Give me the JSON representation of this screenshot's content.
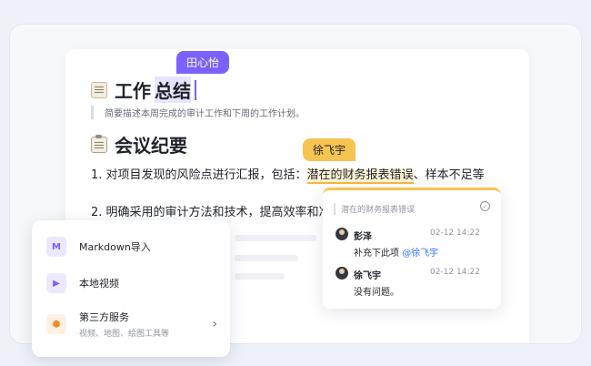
{
  "doc": {
    "heading1": {
      "text_plain": "工作",
      "text_selected": "总结"
    },
    "quote": "简要描述本周完成的审计工作和下周的工作计划。",
    "heading2": "会议纪要",
    "line1": {
      "prefix": "1. 对项目发现的风险点进行汇报，包括：",
      "highlight": "潜在的财务报表错误",
      "suffix": "、样本不足等"
    },
    "line2": "2. 明确采用的审计方法和技术，提高效率和准"
  },
  "collaborators": {
    "purple": {
      "name": "田心怡",
      "color": "#7b61ff"
    },
    "yellow": {
      "name": "徐飞宇",
      "color": "#f6c451"
    }
  },
  "insert_menu": {
    "items": [
      {
        "icon": "M",
        "label": "Markdown导入",
        "sub": ""
      },
      {
        "icon": "▶",
        "label": "本地视频",
        "sub": ""
      },
      {
        "icon": "⬢",
        "label": "第三方服务",
        "sub": "视频、地图、绘图工具等"
      }
    ]
  },
  "comment": {
    "quote": "潜在的财务报表错误",
    "entries": [
      {
        "name": "彭泽",
        "time": "02-12 14:22",
        "text": "补充下此项 ",
        "mention": "@徐飞宇"
      },
      {
        "name": "徐飞宇",
        "time": "02-12 14:22",
        "text": "没有问题。",
        "mention": ""
      }
    ]
  }
}
